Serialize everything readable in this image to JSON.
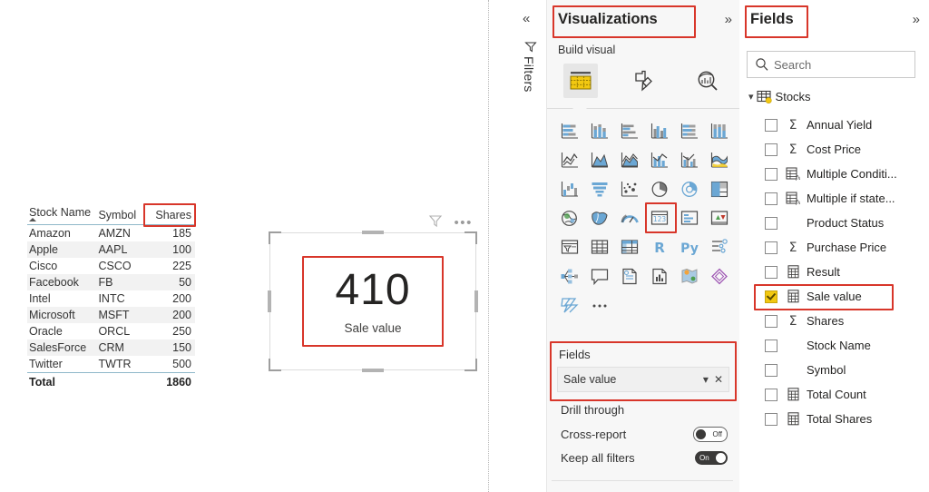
{
  "canvas": {
    "table_visual": {
      "name": "stocks-table",
      "columns": [
        "Stock Name",
        "Symbol",
        "Shares"
      ],
      "sort_column": "Stock Name",
      "sort_direction": "ascending",
      "highlighted_column": "Shares",
      "rows": [
        {
          "stock_name": "Amazon",
          "symbol": "AMZN",
          "shares": "185"
        },
        {
          "stock_name": "Apple",
          "symbol": "AAPL",
          "shares": "100"
        },
        {
          "stock_name": "Cisco",
          "symbol": "CSCO",
          "shares": "225"
        },
        {
          "stock_name": "Facebook",
          "symbol": "FB",
          "shares": "50"
        },
        {
          "stock_name": "Intel",
          "symbol": "INTC",
          "shares": "200"
        },
        {
          "stock_name": "Microsoft",
          "symbol": "MSFT",
          "shares": "200"
        },
        {
          "stock_name": "Oracle",
          "symbol": "ORCL",
          "shares": "250"
        },
        {
          "stock_name": "SalesForce",
          "symbol": "CRM",
          "shares": "150"
        },
        {
          "stock_name": "Twitter",
          "symbol": "TWTR",
          "shares": "500"
        }
      ],
      "total_label": "Total",
      "total_value": "1860"
    },
    "card_visual": {
      "value": "410",
      "label": "Sale value",
      "selected": true,
      "header_icons": [
        "filter-icon",
        "more-options-icon"
      ]
    }
  },
  "filters_pane": {
    "collapse_label": "«",
    "label": "Filters",
    "icon": "funnel-icon"
  },
  "visualizations_pane": {
    "title": "Visualizations",
    "expand_label": "»",
    "build_visual_label": "Build visual",
    "tabs": [
      {
        "name": "build-visual",
        "icon": "fields-grid-icon",
        "selected": true
      },
      {
        "name": "format-visual",
        "icon": "paintbrush-icon",
        "selected": false
      },
      {
        "name": "analytics",
        "icon": "magnifier-chart-icon",
        "selected": false
      }
    ],
    "visual_types": [
      [
        "stacked-bar-chart",
        "stacked-column-chart",
        "clustered-bar-chart",
        "clustered-column-chart",
        "100-percent-stacked-bar-chart",
        "100-percent-stacked-column-chart"
      ],
      [
        "line-chart",
        "area-chart",
        "stacked-area-chart",
        "line-and-stacked-column-chart",
        "line-and-clustered-column-chart",
        "ribbon-chart"
      ],
      [
        "waterfall-chart",
        "funnel-chart",
        "scatter-chart",
        "pie-chart",
        "donut-chart",
        "treemap"
      ],
      [
        "map",
        "filled-map",
        "gauge-chart",
        "card",
        "multi-row-card",
        "kpi"
      ],
      [
        "slicer",
        "table",
        "matrix",
        "r-script-visual",
        "python-visual",
        "key-influencers"
      ],
      [
        "decomposition-tree",
        "q-and-a",
        "narrative",
        "paginated-report",
        "arcgis-maps",
        "power-apps"
      ],
      [
        "power-automate",
        "more-visuals"
      ]
    ],
    "selected_visual_type": "card",
    "fields_well": {
      "title": "Fields",
      "field": "Sale value",
      "dropdown_icon": "chevron-down-icon",
      "remove_icon": "close-icon"
    },
    "drill_through": {
      "title": "Drill through",
      "cross_report": {
        "label": "Cross-report",
        "state": "Off"
      },
      "keep_all_filters": {
        "label": "Keep all filters",
        "state": "On"
      }
    }
  },
  "fields_pane": {
    "title": "Fields",
    "expand_label": "»",
    "search": {
      "placeholder": "Search",
      "value": "",
      "icon": "search-icon"
    },
    "table": {
      "name": "Stocks",
      "expanded": true,
      "icon": "table-icon"
    },
    "fields": [
      {
        "label": "Annual Yield",
        "icon": "sigma-icon",
        "checked": false
      },
      {
        "label": "Cost Price",
        "icon": "sigma-icon",
        "checked": false
      },
      {
        "label": "Multiple Conditi...",
        "icon": "calculated-column-icon",
        "checked": false
      },
      {
        "label": "Multiple if state...",
        "icon": "calculated-column-icon",
        "checked": false
      },
      {
        "label": "Product Status",
        "icon": "none",
        "checked": false
      },
      {
        "label": "Purchase Price",
        "icon": "sigma-icon",
        "checked": false
      },
      {
        "label": "Result",
        "icon": "measure-icon",
        "checked": false
      },
      {
        "label": "Sale value",
        "icon": "measure-icon",
        "checked": true,
        "highlighted": true
      },
      {
        "label": "Shares",
        "icon": "sigma-icon",
        "checked": false
      },
      {
        "label": "Stock Name",
        "icon": "none",
        "checked": false
      },
      {
        "label": "Symbol",
        "icon": "none",
        "checked": false
      },
      {
        "label": "Total Count",
        "icon": "measure-icon",
        "checked": false
      },
      {
        "label": "Total Shares",
        "icon": "measure-icon",
        "checked": false
      }
    ]
  },
  "colors": {
    "highlight_box": "#d8362a",
    "powerbi_yellow": "#f2c811",
    "pane_background": "#f7f7f7",
    "chart_icon_blue": "#6ba7d4"
  }
}
